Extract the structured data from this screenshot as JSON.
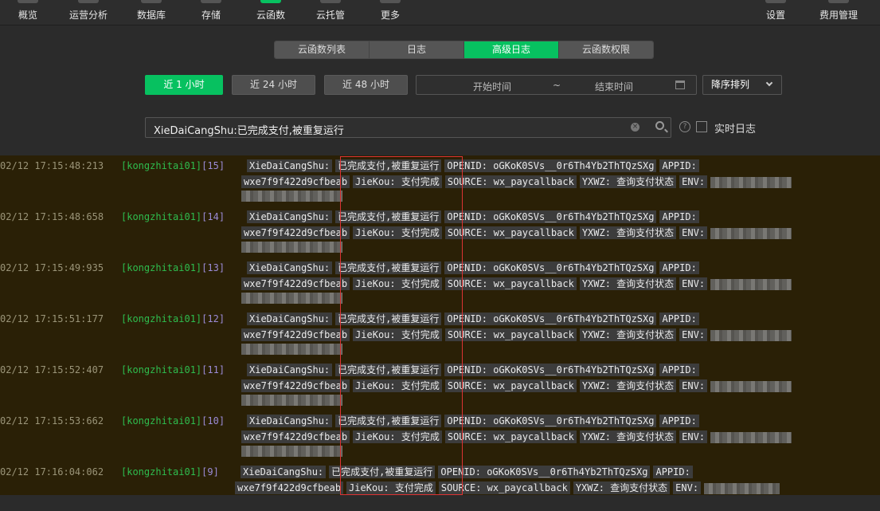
{
  "toolbar": {
    "items": [
      {
        "label": "概览"
      },
      {
        "label": "运营分析"
      },
      {
        "label": "数据库"
      },
      {
        "label": "存储"
      },
      {
        "label": "云函数"
      },
      {
        "label": "云托管"
      },
      {
        "label": "更多"
      },
      {
        "label": "设置"
      },
      {
        "label": "费用管理"
      }
    ]
  },
  "tabs": [
    {
      "label": "云函数列表"
    },
    {
      "label": "日志"
    },
    {
      "label": "高级日志"
    },
    {
      "label": "云函数权限"
    }
  ],
  "filters": {
    "last1h": "近 1 小时",
    "last24h": "近 24 小时",
    "last48h": "近 48 小时",
    "start_placeholder": "开始时间",
    "separator": "~",
    "end_placeholder": "结束时间",
    "sort_label": "降序排列"
  },
  "search": {
    "value": "XieDaiCangShu:已完成支付,被重复运行",
    "realtime_label": "实时日志",
    "help": "?"
  },
  "logs": [
    {
      "ts": "02/12 17:15:48:213",
      "src": "[kongzhitai01]",
      "num": "[15]"
    },
    {
      "ts": "02/12 17:15:48:658",
      "src": "[kongzhitai01]",
      "num": "[14]"
    },
    {
      "ts": "02/12 17:15:49:935",
      "src": "[kongzhitai01]",
      "num": "[13]"
    },
    {
      "ts": "02/12 17:15:51:177",
      "src": "[kongzhitai01]",
      "num": "[12]"
    },
    {
      "ts": "02/12 17:15:52:407",
      "src": "[kongzhitai01]",
      "num": "[11]"
    },
    {
      "ts": "02/12 17:15:53:662",
      "src": "[kongzhitai01]",
      "num": "[10]"
    },
    {
      "ts": "02/12 17:16:04:062",
      "src": "[kongzhitai01]",
      "num": "[9]"
    }
  ],
  "log_tokens": {
    "key1": "XieDaiCangShu:",
    "val1": "已完成支付,被重复运行",
    "openid": "OPENID: oGKoK0SVs__0r6Th4Yb2ThTQzSXg",
    "appid_key": "APPID:",
    "appid_val": "wxe7f9f422d9cfbeab",
    "jiekou": "JieKou: 支付完成",
    "source": "SOURCE: wx_paycallback",
    "yxwz": "YXWZ: 查询支付状态",
    "env": "ENV:"
  }
}
